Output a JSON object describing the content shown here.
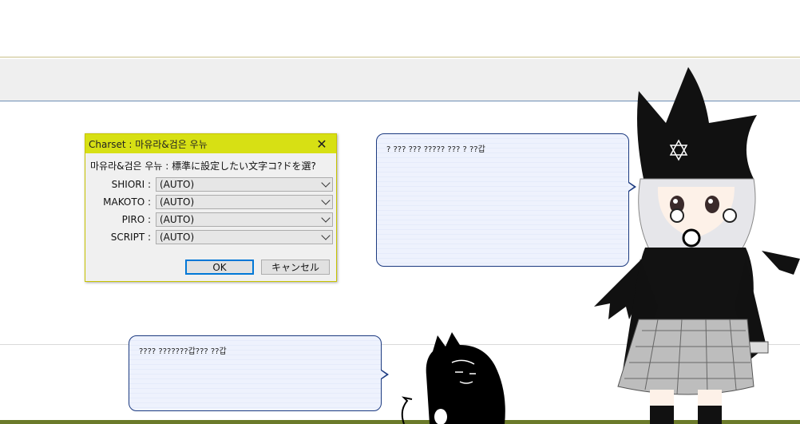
{
  "dialog": {
    "title": "Charset : 마유라&검은 우뉴",
    "prompt": "마유라&검은 우뉴 : 標準に設定したい文字コ?ドを選?",
    "rows": [
      {
        "label": "SHIORI :",
        "value": "(AUTO)"
      },
      {
        "label": "MAKOTO :",
        "value": "(AUTO)"
      },
      {
        "label": "PIRO :",
        "value": "(AUTO)"
      },
      {
        "label": "SCRIPT :",
        "value": "(AUTO)"
      }
    ],
    "ok_label": "OK",
    "cancel_label": "キャンセル"
  },
  "balloons": {
    "main_text": "? ??? ??? ????? ??? ? ??갑",
    "sub_text": "???? ???????갑??? ??갑"
  },
  "colors": {
    "titlebar": "#d7e014",
    "balloon_border": "#1c3a80",
    "balloon_fill": "#eef2fd",
    "primary_border": "#0078d7"
  }
}
